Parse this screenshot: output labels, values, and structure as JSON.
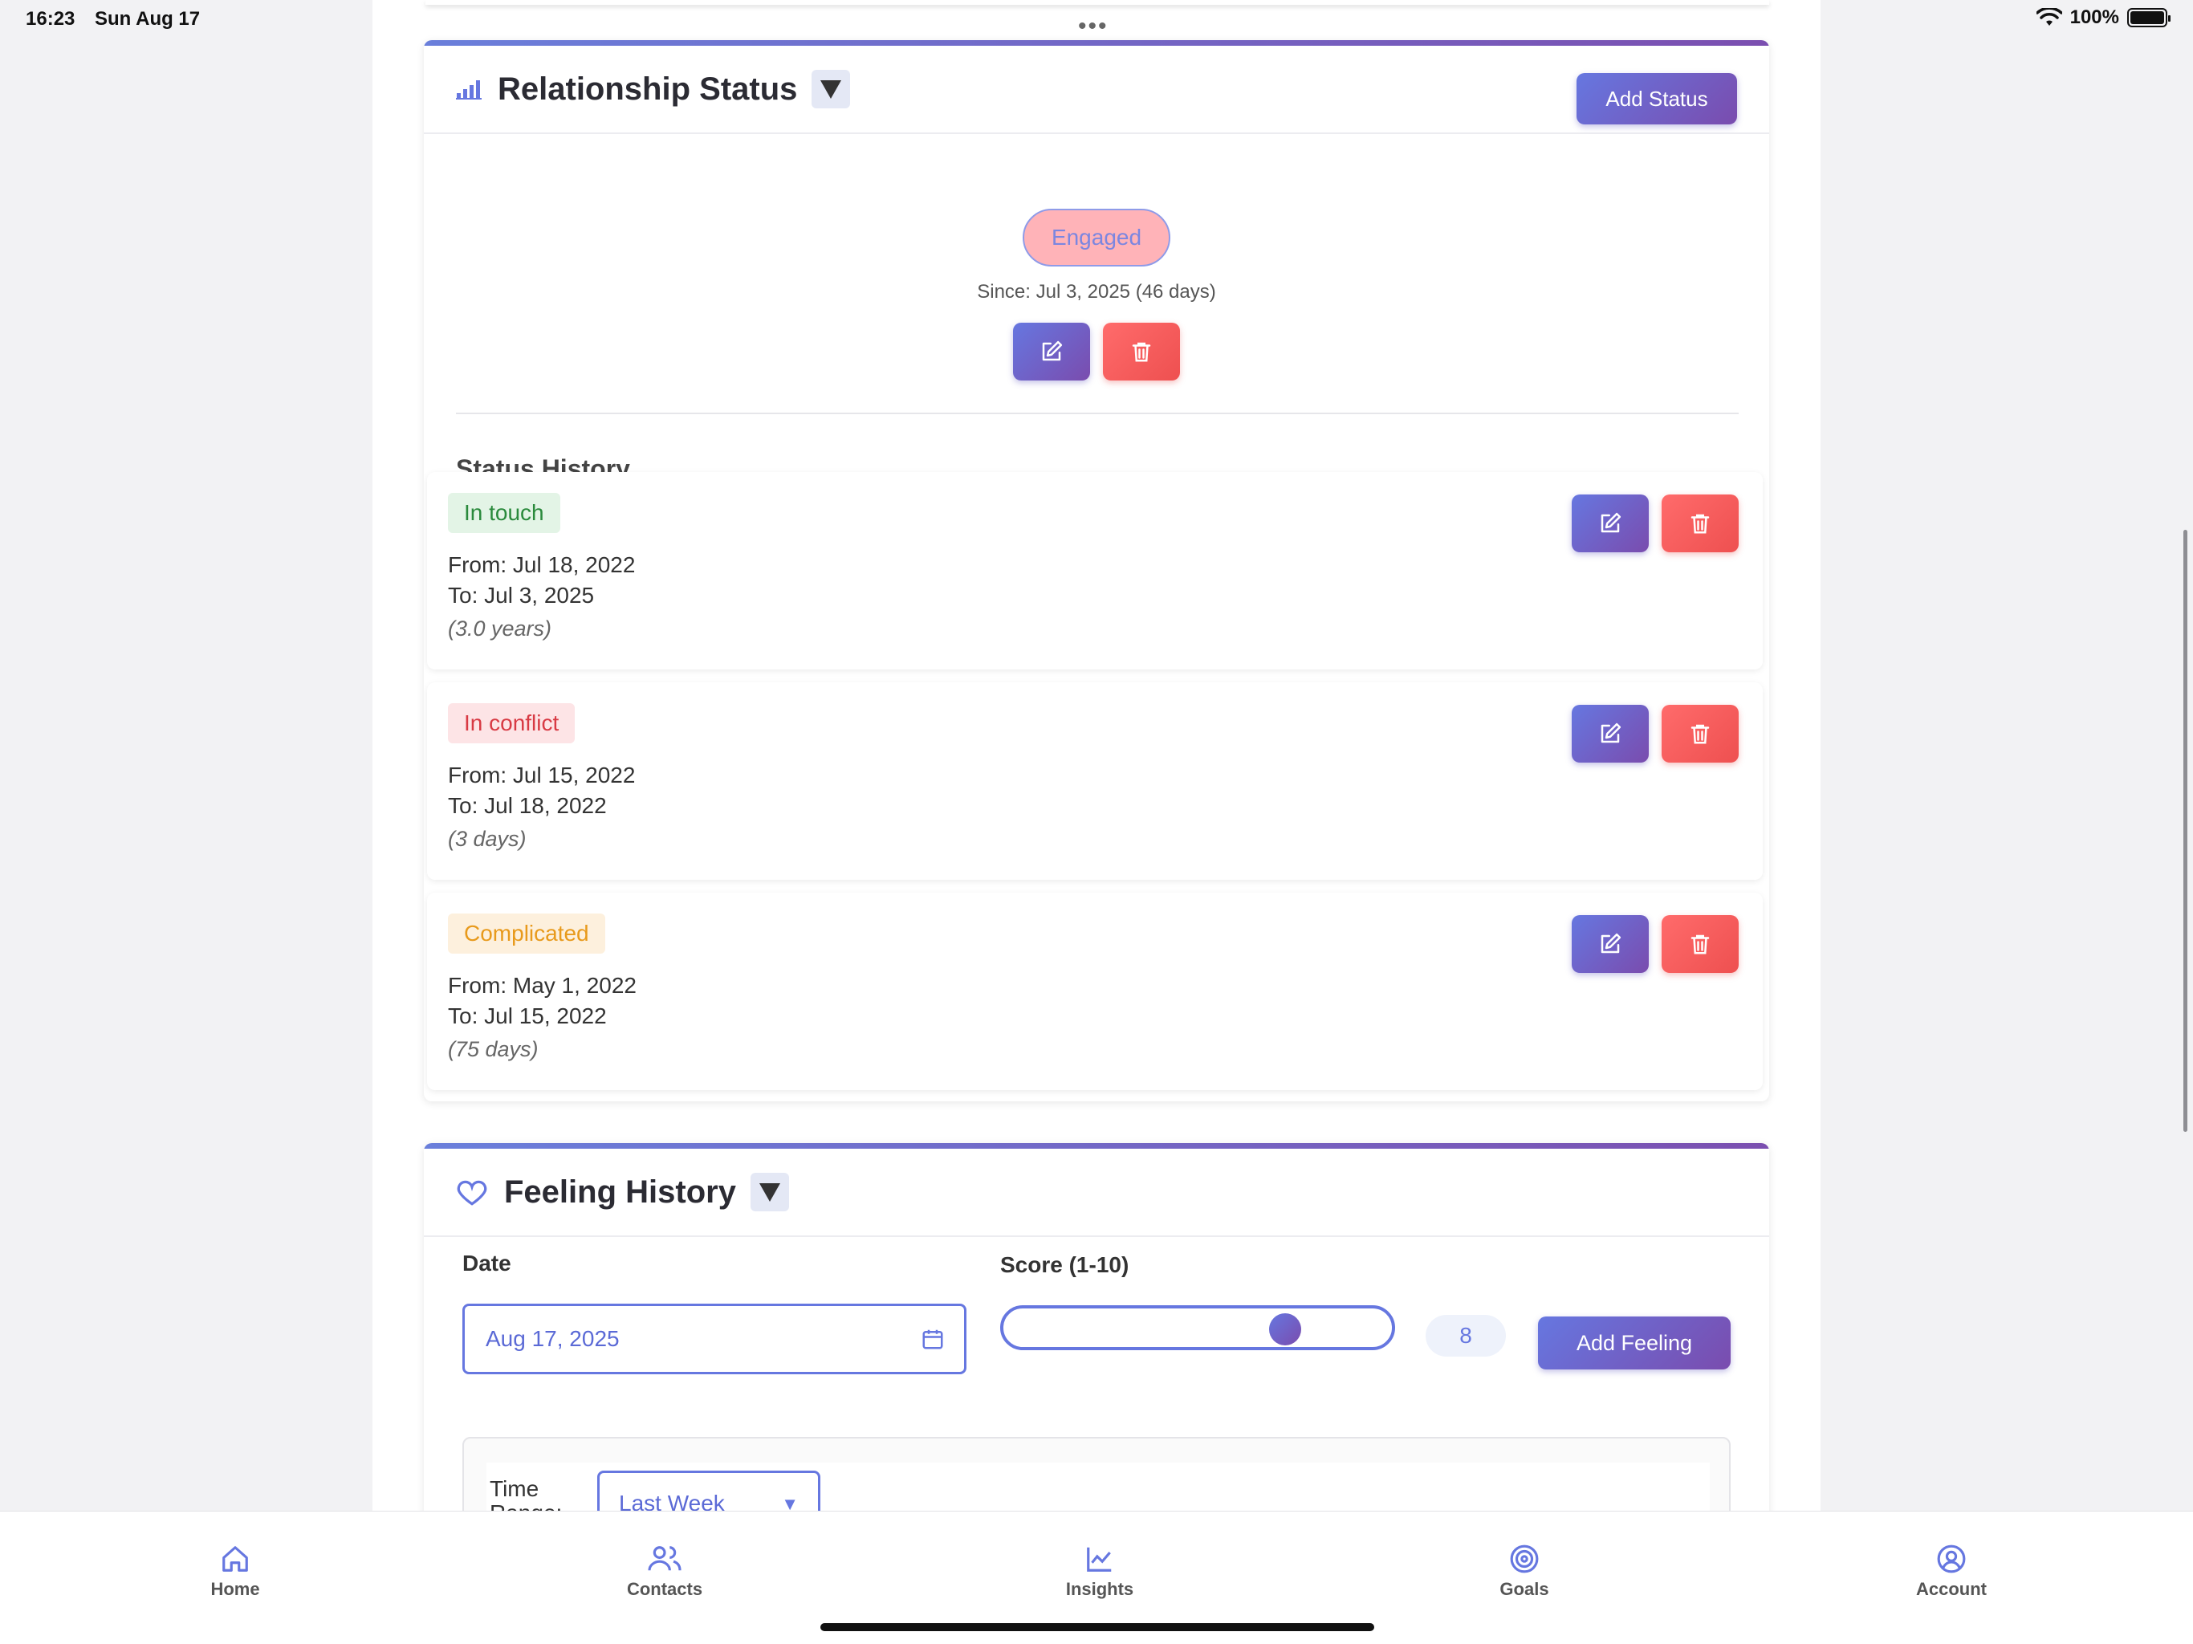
{
  "status_bar": {
    "time": "16:23",
    "date": "Sun Aug 17",
    "battery": "100%"
  },
  "relationship": {
    "title": "Relationship Status",
    "add_button": "Add Status",
    "current": {
      "label": "Engaged",
      "since": "Since: Jul 3, 2025 (46 days)"
    },
    "history_title": "Status History",
    "history": [
      {
        "label": "In touch",
        "from": "From: Jul 18, 2022",
        "to": "To: Jul 3, 2025",
        "duration": "(3.0 years)",
        "badge_bg": "#e3f4e6",
        "badge_fg": "#2a8a3c"
      },
      {
        "label": "In conflict",
        "from": "From: Jul 15, 2022",
        "to": "To: Jul 18, 2022",
        "duration": "(3 days)",
        "badge_bg": "#fde4e6",
        "badge_fg": "#d83a44"
      },
      {
        "label": "Complicated",
        "from": "From: May 1, 2022",
        "to": "To: Jul 15, 2022",
        "duration": "(75 days)",
        "badge_bg": "#fdf0dd",
        "badge_fg": "#e89a1c"
      }
    ]
  },
  "feeling": {
    "title": "Feeling History",
    "date_label": "Date",
    "date_value": "Aug 17, 2025",
    "score_label": "Score (1-10)",
    "score_value": "8",
    "score_fraction": 0.75,
    "add_button": "Add Feeling",
    "range_label": "Time Range:",
    "range_value": "Last Week"
  },
  "tabs": [
    {
      "label": "Home",
      "icon": "home-icon"
    },
    {
      "label": "Contacts",
      "icon": "contacts-icon"
    },
    {
      "label": "Insights",
      "icon": "insights-icon"
    },
    {
      "label": "Goals",
      "icon": "goals-icon"
    },
    {
      "label": "Account",
      "icon": "account-icon"
    }
  ],
  "colors": {
    "accent": "#6677e0",
    "accent_dark": "#7a4cae",
    "danger": "#ee5050"
  }
}
